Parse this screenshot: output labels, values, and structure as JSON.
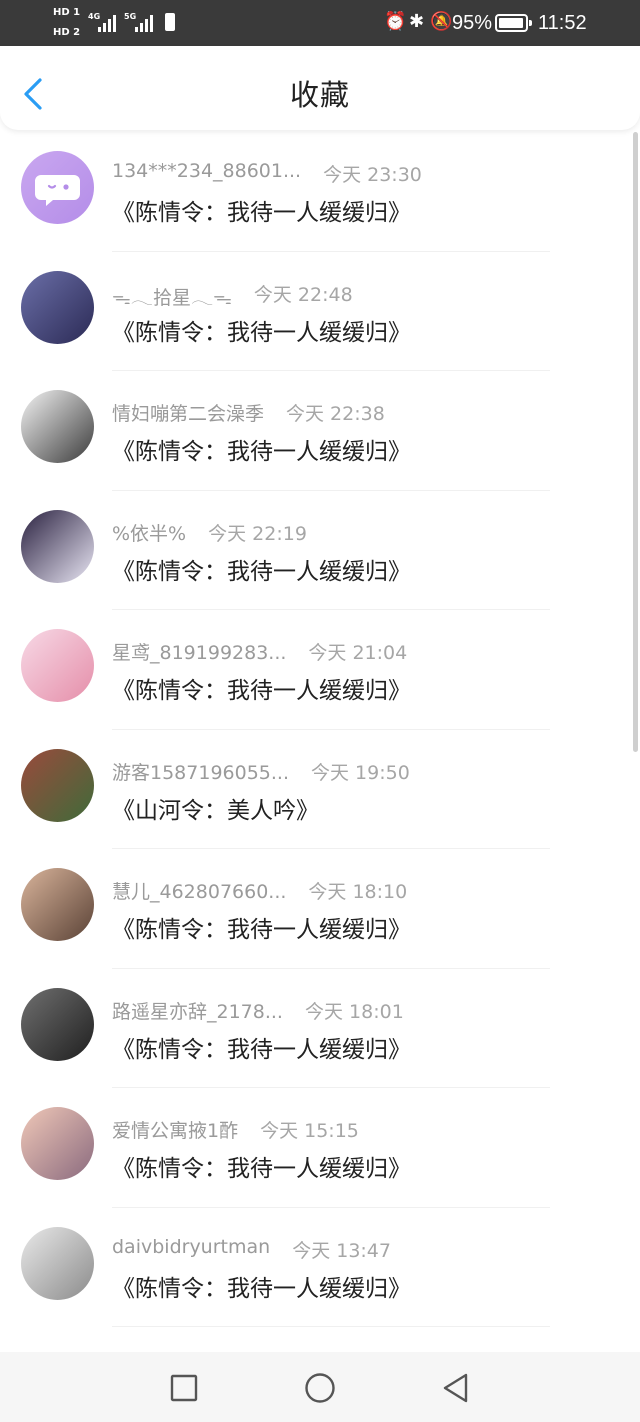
{
  "status_bar": {
    "hd1": "HD 1",
    "hd2": "HD 2",
    "net1": "4G",
    "net2": "5G",
    "battery_percent": "95%",
    "battery_level": 0.95,
    "time": "11:52"
  },
  "header": {
    "title": "收藏",
    "accent_color": "#2a9df4"
  },
  "items": [
    {
      "name": "134***234_88601...",
      "time": "今天 23:30",
      "title": "《陈情令：我待一人缓缓归》"
    },
    {
      "name": "ᯓ𓂃拾星𓂃ᯓ",
      "time": "今天 22:48",
      "title": "《陈情令：我待一人缓缓归》"
    },
    {
      "name": "情妇嘣第二会澡季",
      "time": "今天 22:38",
      "title": "《陈情令：我待一人缓缓归》"
    },
    {
      "name": "%依半%",
      "time": "今天 22:19",
      "title": "《陈情令：我待一人缓缓归》"
    },
    {
      "name": "星鸢_819199283...",
      "time": "今天 21:04",
      "title": "《陈情令：我待一人缓缓归》"
    },
    {
      "name": "游客1587196055...",
      "time": "今天 19:50",
      "title": "《山河令：美人吟》"
    },
    {
      "name": "慧儿_462807660...",
      "time": "今天 18:10",
      "title": "《陈情令：我待一人缓缓归》"
    },
    {
      "name": "路遥星亦辞_2178...",
      "time": "今天 18:01",
      "title": "《陈情令：我待一人缓缓归》"
    },
    {
      "name": "爱情公寓掖1酢",
      "time": "今天 15:15",
      "title": "《陈情令：我待一人缓缓归》"
    },
    {
      "name": "daivbidryurtman",
      "time": "今天 13:47",
      "title": "《陈情令：我待一人缓缓归》"
    }
  ],
  "avatars": [
    {
      "icon": "chat-bubble-icon",
      "colors": [
        "#c9a7f0",
        "#b48de8"
      ]
    },
    {
      "icon": "avatar-photo",
      "colors": [
        "#6b6fa8",
        "#2b2a55"
      ]
    },
    {
      "icon": "avatar-photo",
      "colors": [
        "#f4f4f4",
        "#3b3b3b"
      ]
    },
    {
      "icon": "avatar-photo",
      "colors": [
        "#2a2140",
        "#e9e6f4"
      ]
    },
    {
      "icon": "avatar-photo",
      "colors": [
        "#f7d9e6",
        "#e58ea9"
      ]
    },
    {
      "icon": "avatar-photo",
      "colors": [
        "#9a4a3c",
        "#3f6b3a"
      ]
    },
    {
      "icon": "avatar-photo",
      "colors": [
        "#d9b49b",
        "#5a4236"
      ]
    },
    {
      "icon": "avatar-photo",
      "colors": [
        "#707070",
        "#1f1f1f"
      ]
    },
    {
      "icon": "avatar-photo",
      "colors": [
        "#f0c8b8",
        "#8a6a7e"
      ]
    },
    {
      "icon": "avatar-photo",
      "colors": [
        "#e9e9e9",
        "#8b8b8b"
      ]
    }
  ],
  "nav_bar": {
    "icons": [
      "recent-apps-icon",
      "home-icon",
      "back-triangle-icon"
    ]
  }
}
